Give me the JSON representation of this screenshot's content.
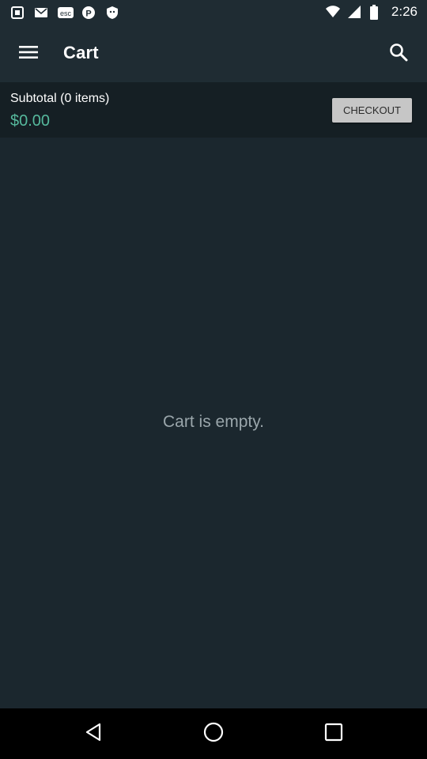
{
  "status_bar": {
    "time": "2:26",
    "left_icons": [
      "notification-icon",
      "mail-icon",
      "esc-icon",
      "pinterest-icon",
      "shield-icon"
    ],
    "right_icons": [
      "wifi-icon",
      "signal-icon",
      "battery-icon"
    ]
  },
  "toolbar": {
    "title": "Cart",
    "menu_icon": "menu-icon",
    "search_icon": "search-icon"
  },
  "subtotal": {
    "label": "Subtotal (0 items)",
    "amount": "$0.00",
    "checkout_label": "CHECKOUT"
  },
  "content": {
    "empty_message": "Cart is empty."
  },
  "nav_bar": {
    "back_icon": "back-icon",
    "home_icon": "home-icon",
    "recent_icon": "recent-apps-icon"
  },
  "colors": {
    "background": "#1b272e",
    "toolbar": "#1f2c33",
    "subtotal_bar": "#151f24",
    "price_accent": "#56b99d",
    "checkout_button": "#c6c6c6"
  }
}
